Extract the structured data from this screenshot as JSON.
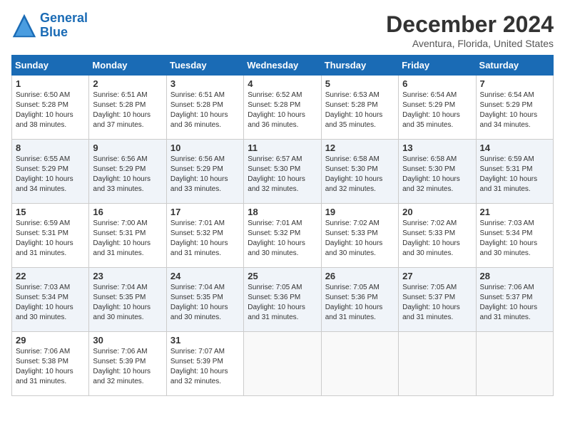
{
  "header": {
    "logo_line1": "General",
    "logo_line2": "Blue",
    "title": "December 2024",
    "subtitle": "Aventura, Florida, United States"
  },
  "days_of_week": [
    "Sunday",
    "Monday",
    "Tuesday",
    "Wednesday",
    "Thursday",
    "Friday",
    "Saturday"
  ],
  "weeks": [
    [
      {
        "day": "1",
        "info": "Sunrise: 6:50 AM\nSunset: 5:28 PM\nDaylight: 10 hours\nand 38 minutes."
      },
      {
        "day": "2",
        "info": "Sunrise: 6:51 AM\nSunset: 5:28 PM\nDaylight: 10 hours\nand 37 minutes."
      },
      {
        "day": "3",
        "info": "Sunrise: 6:51 AM\nSunset: 5:28 PM\nDaylight: 10 hours\nand 36 minutes."
      },
      {
        "day": "4",
        "info": "Sunrise: 6:52 AM\nSunset: 5:28 PM\nDaylight: 10 hours\nand 36 minutes."
      },
      {
        "day": "5",
        "info": "Sunrise: 6:53 AM\nSunset: 5:28 PM\nDaylight: 10 hours\nand 35 minutes."
      },
      {
        "day": "6",
        "info": "Sunrise: 6:54 AM\nSunset: 5:29 PM\nDaylight: 10 hours\nand 35 minutes."
      },
      {
        "day": "7",
        "info": "Sunrise: 6:54 AM\nSunset: 5:29 PM\nDaylight: 10 hours\nand 34 minutes."
      }
    ],
    [
      {
        "day": "8",
        "info": "Sunrise: 6:55 AM\nSunset: 5:29 PM\nDaylight: 10 hours\nand 34 minutes."
      },
      {
        "day": "9",
        "info": "Sunrise: 6:56 AM\nSunset: 5:29 PM\nDaylight: 10 hours\nand 33 minutes."
      },
      {
        "day": "10",
        "info": "Sunrise: 6:56 AM\nSunset: 5:29 PM\nDaylight: 10 hours\nand 33 minutes."
      },
      {
        "day": "11",
        "info": "Sunrise: 6:57 AM\nSunset: 5:30 PM\nDaylight: 10 hours\nand 32 minutes."
      },
      {
        "day": "12",
        "info": "Sunrise: 6:58 AM\nSunset: 5:30 PM\nDaylight: 10 hours\nand 32 minutes."
      },
      {
        "day": "13",
        "info": "Sunrise: 6:58 AM\nSunset: 5:30 PM\nDaylight: 10 hours\nand 32 minutes."
      },
      {
        "day": "14",
        "info": "Sunrise: 6:59 AM\nSunset: 5:31 PM\nDaylight: 10 hours\nand 31 minutes."
      }
    ],
    [
      {
        "day": "15",
        "info": "Sunrise: 6:59 AM\nSunset: 5:31 PM\nDaylight: 10 hours\nand 31 minutes."
      },
      {
        "day": "16",
        "info": "Sunrise: 7:00 AM\nSunset: 5:31 PM\nDaylight: 10 hours\nand 31 minutes."
      },
      {
        "day": "17",
        "info": "Sunrise: 7:01 AM\nSunset: 5:32 PM\nDaylight: 10 hours\nand 31 minutes."
      },
      {
        "day": "18",
        "info": "Sunrise: 7:01 AM\nSunset: 5:32 PM\nDaylight: 10 hours\nand 30 minutes."
      },
      {
        "day": "19",
        "info": "Sunrise: 7:02 AM\nSunset: 5:33 PM\nDaylight: 10 hours\nand 30 minutes."
      },
      {
        "day": "20",
        "info": "Sunrise: 7:02 AM\nSunset: 5:33 PM\nDaylight: 10 hours\nand 30 minutes."
      },
      {
        "day": "21",
        "info": "Sunrise: 7:03 AM\nSunset: 5:34 PM\nDaylight: 10 hours\nand 30 minutes."
      }
    ],
    [
      {
        "day": "22",
        "info": "Sunrise: 7:03 AM\nSunset: 5:34 PM\nDaylight: 10 hours\nand 30 minutes."
      },
      {
        "day": "23",
        "info": "Sunrise: 7:04 AM\nSunset: 5:35 PM\nDaylight: 10 hours\nand 30 minutes."
      },
      {
        "day": "24",
        "info": "Sunrise: 7:04 AM\nSunset: 5:35 PM\nDaylight: 10 hours\nand 30 minutes."
      },
      {
        "day": "25",
        "info": "Sunrise: 7:05 AM\nSunset: 5:36 PM\nDaylight: 10 hours\nand 31 minutes."
      },
      {
        "day": "26",
        "info": "Sunrise: 7:05 AM\nSunset: 5:36 PM\nDaylight: 10 hours\nand 31 minutes."
      },
      {
        "day": "27",
        "info": "Sunrise: 7:05 AM\nSunset: 5:37 PM\nDaylight: 10 hours\nand 31 minutes."
      },
      {
        "day": "28",
        "info": "Sunrise: 7:06 AM\nSunset: 5:37 PM\nDaylight: 10 hours\nand 31 minutes."
      }
    ],
    [
      {
        "day": "29",
        "info": "Sunrise: 7:06 AM\nSunset: 5:38 PM\nDaylight: 10 hours\nand 31 minutes."
      },
      {
        "day": "30",
        "info": "Sunrise: 7:06 AM\nSunset: 5:39 PM\nDaylight: 10 hours\nand 32 minutes."
      },
      {
        "day": "31",
        "info": "Sunrise: 7:07 AM\nSunset: 5:39 PM\nDaylight: 10 hours\nand 32 minutes."
      },
      {
        "day": "",
        "info": ""
      },
      {
        "day": "",
        "info": ""
      },
      {
        "day": "",
        "info": ""
      },
      {
        "day": "",
        "info": ""
      }
    ]
  ]
}
